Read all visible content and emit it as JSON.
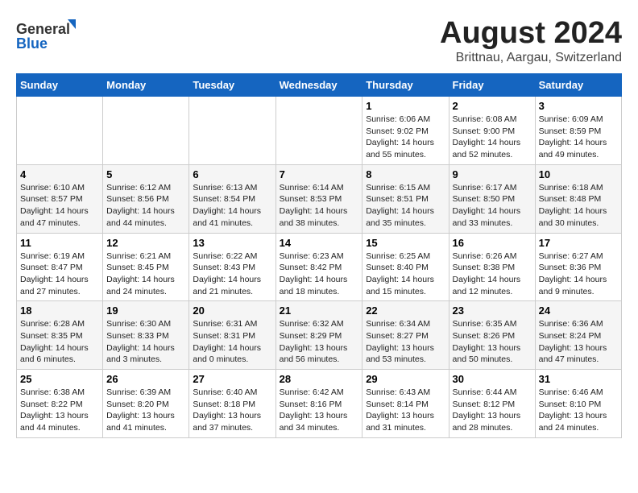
{
  "header": {
    "logo_line1": "General",
    "logo_line2": "Blue",
    "main_title": "August 2024",
    "subtitle": "Brittnau, Aargau, Switzerland"
  },
  "days_of_week": [
    "Sunday",
    "Monday",
    "Tuesday",
    "Wednesday",
    "Thursday",
    "Friday",
    "Saturday"
  ],
  "weeks": [
    [
      {
        "num": "",
        "info": ""
      },
      {
        "num": "",
        "info": ""
      },
      {
        "num": "",
        "info": ""
      },
      {
        "num": "",
        "info": ""
      },
      {
        "num": "1",
        "info": "Sunrise: 6:06 AM\nSunset: 9:02 PM\nDaylight: 14 hours\nand 55 minutes."
      },
      {
        "num": "2",
        "info": "Sunrise: 6:08 AM\nSunset: 9:00 PM\nDaylight: 14 hours\nand 52 minutes."
      },
      {
        "num": "3",
        "info": "Sunrise: 6:09 AM\nSunset: 8:59 PM\nDaylight: 14 hours\nand 49 minutes."
      }
    ],
    [
      {
        "num": "4",
        "info": "Sunrise: 6:10 AM\nSunset: 8:57 PM\nDaylight: 14 hours\nand 47 minutes."
      },
      {
        "num": "5",
        "info": "Sunrise: 6:12 AM\nSunset: 8:56 PM\nDaylight: 14 hours\nand 44 minutes."
      },
      {
        "num": "6",
        "info": "Sunrise: 6:13 AM\nSunset: 8:54 PM\nDaylight: 14 hours\nand 41 minutes."
      },
      {
        "num": "7",
        "info": "Sunrise: 6:14 AM\nSunset: 8:53 PM\nDaylight: 14 hours\nand 38 minutes."
      },
      {
        "num": "8",
        "info": "Sunrise: 6:15 AM\nSunset: 8:51 PM\nDaylight: 14 hours\nand 35 minutes."
      },
      {
        "num": "9",
        "info": "Sunrise: 6:17 AM\nSunset: 8:50 PM\nDaylight: 14 hours\nand 33 minutes."
      },
      {
        "num": "10",
        "info": "Sunrise: 6:18 AM\nSunset: 8:48 PM\nDaylight: 14 hours\nand 30 minutes."
      }
    ],
    [
      {
        "num": "11",
        "info": "Sunrise: 6:19 AM\nSunset: 8:47 PM\nDaylight: 14 hours\nand 27 minutes."
      },
      {
        "num": "12",
        "info": "Sunrise: 6:21 AM\nSunset: 8:45 PM\nDaylight: 14 hours\nand 24 minutes."
      },
      {
        "num": "13",
        "info": "Sunrise: 6:22 AM\nSunset: 8:43 PM\nDaylight: 14 hours\nand 21 minutes."
      },
      {
        "num": "14",
        "info": "Sunrise: 6:23 AM\nSunset: 8:42 PM\nDaylight: 14 hours\nand 18 minutes."
      },
      {
        "num": "15",
        "info": "Sunrise: 6:25 AM\nSunset: 8:40 PM\nDaylight: 14 hours\nand 15 minutes."
      },
      {
        "num": "16",
        "info": "Sunrise: 6:26 AM\nSunset: 8:38 PM\nDaylight: 14 hours\nand 12 minutes."
      },
      {
        "num": "17",
        "info": "Sunrise: 6:27 AM\nSunset: 8:36 PM\nDaylight: 14 hours\nand 9 minutes."
      }
    ],
    [
      {
        "num": "18",
        "info": "Sunrise: 6:28 AM\nSunset: 8:35 PM\nDaylight: 14 hours\nand 6 minutes."
      },
      {
        "num": "19",
        "info": "Sunrise: 6:30 AM\nSunset: 8:33 PM\nDaylight: 14 hours\nand 3 minutes."
      },
      {
        "num": "20",
        "info": "Sunrise: 6:31 AM\nSunset: 8:31 PM\nDaylight: 14 hours\nand 0 minutes."
      },
      {
        "num": "21",
        "info": "Sunrise: 6:32 AM\nSunset: 8:29 PM\nDaylight: 13 hours\nand 56 minutes."
      },
      {
        "num": "22",
        "info": "Sunrise: 6:34 AM\nSunset: 8:27 PM\nDaylight: 13 hours\nand 53 minutes."
      },
      {
        "num": "23",
        "info": "Sunrise: 6:35 AM\nSunset: 8:26 PM\nDaylight: 13 hours\nand 50 minutes."
      },
      {
        "num": "24",
        "info": "Sunrise: 6:36 AM\nSunset: 8:24 PM\nDaylight: 13 hours\nand 47 minutes."
      }
    ],
    [
      {
        "num": "25",
        "info": "Sunrise: 6:38 AM\nSunset: 8:22 PM\nDaylight: 13 hours\nand 44 minutes."
      },
      {
        "num": "26",
        "info": "Sunrise: 6:39 AM\nSunset: 8:20 PM\nDaylight: 13 hours\nand 41 minutes."
      },
      {
        "num": "27",
        "info": "Sunrise: 6:40 AM\nSunset: 8:18 PM\nDaylight: 13 hours\nand 37 minutes."
      },
      {
        "num": "28",
        "info": "Sunrise: 6:42 AM\nSunset: 8:16 PM\nDaylight: 13 hours\nand 34 minutes."
      },
      {
        "num": "29",
        "info": "Sunrise: 6:43 AM\nSunset: 8:14 PM\nDaylight: 13 hours\nand 31 minutes."
      },
      {
        "num": "30",
        "info": "Sunrise: 6:44 AM\nSunset: 8:12 PM\nDaylight: 13 hours\nand 28 minutes."
      },
      {
        "num": "31",
        "info": "Sunrise: 6:46 AM\nSunset: 8:10 PM\nDaylight: 13 hours\nand 24 minutes."
      }
    ]
  ]
}
